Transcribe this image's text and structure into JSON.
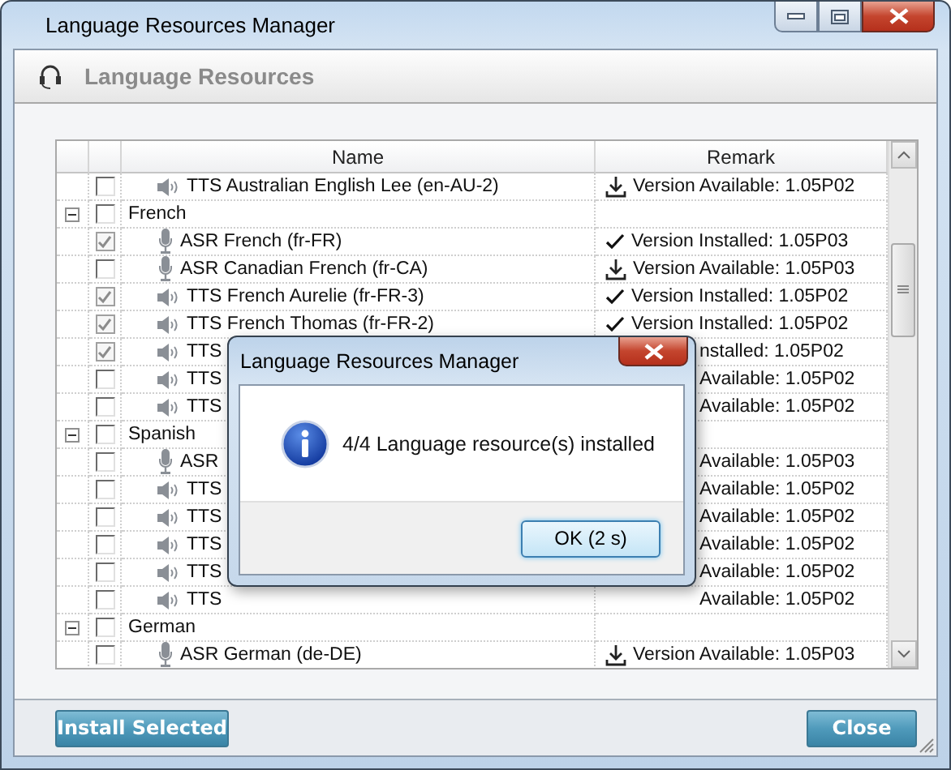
{
  "window": {
    "title": "Language Resources Manager"
  },
  "header": {
    "title": "Language Resources"
  },
  "table": {
    "columns": [
      "Name",
      "Remark"
    ],
    "rows": [
      {
        "kind": "tts",
        "name": "TTS Australian English Lee (en-AU-2)",
        "checked": false,
        "remark": {
          "kind": "available",
          "text": "Version Available: 1.05P02"
        }
      },
      {
        "kind": "group",
        "name": "French",
        "expanded": true,
        "checked": false,
        "children": [
          {
            "kind": "asr",
            "name": "ASR French (fr-FR)",
            "checked": true,
            "remark": {
              "kind": "installed",
              "text": "Version Installed: 1.05P03"
            }
          },
          {
            "kind": "asr",
            "name": "ASR Canadian French (fr-CA)",
            "checked": false,
            "remark": {
              "kind": "available",
              "text": "Version Available: 1.05P03"
            }
          },
          {
            "kind": "tts",
            "name": "TTS French Aurelie (fr-FR-3)",
            "checked": true,
            "remark": {
              "kind": "installed",
              "text": "Version Installed: 1.05P02"
            }
          },
          {
            "kind": "tts",
            "name": "TTS French Thomas (fr-FR-2)",
            "checked": true,
            "remark": {
              "kind": "installed",
              "text": "Version Installed: 1.05P02"
            }
          },
          {
            "kind": "tts",
            "name": "TTS",
            "checked": true,
            "remark": {
              "text": "nstalled: 1.05P02"
            }
          },
          {
            "kind": "tts",
            "name": "TTS",
            "checked": false,
            "remark": {
              "text": "Available: 1.05P02"
            }
          },
          {
            "kind": "tts",
            "name": "TTS",
            "checked": false,
            "remark": {
              "text": "Available: 1.05P02"
            }
          }
        ]
      },
      {
        "kind": "group",
        "name": "Spanish",
        "expanded": true,
        "checked": false,
        "children": [
          {
            "kind": "asr",
            "name": "ASR",
            "checked": false,
            "remark": {
              "text": "Available: 1.05P03"
            }
          },
          {
            "kind": "tts",
            "name": "TTS",
            "checked": false,
            "remark": {
              "text": "Available: 1.05P02"
            }
          },
          {
            "kind": "tts",
            "name": "TTS",
            "checked": false,
            "remark": {
              "text": "Available: 1.05P02"
            }
          },
          {
            "kind": "tts",
            "name": "TTS",
            "checked": false,
            "remark": {
              "text": "Available: 1.05P02"
            }
          },
          {
            "kind": "tts",
            "name": "TTS",
            "checked": false,
            "remark": {
              "text": "Available: 1.05P02"
            }
          },
          {
            "kind": "tts",
            "name": "TTS",
            "checked": false,
            "remark": {
              "text": "Available: 1.05P02"
            }
          }
        ]
      },
      {
        "kind": "group",
        "name": "German",
        "expanded": true,
        "checked": false,
        "children": [
          {
            "kind": "asr",
            "name": "ASR German (de-DE)",
            "checked": false,
            "remark": {
              "kind": "available",
              "text": "Version Available: 1.05P03"
            }
          }
        ]
      }
    ]
  },
  "buttons": {
    "install": "Install Selected",
    "close": "Close"
  },
  "dialog": {
    "title": "Language Resources Manager",
    "message": "4/4 Language resource(s) installed",
    "ok_button": "OK (2 s)"
  }
}
